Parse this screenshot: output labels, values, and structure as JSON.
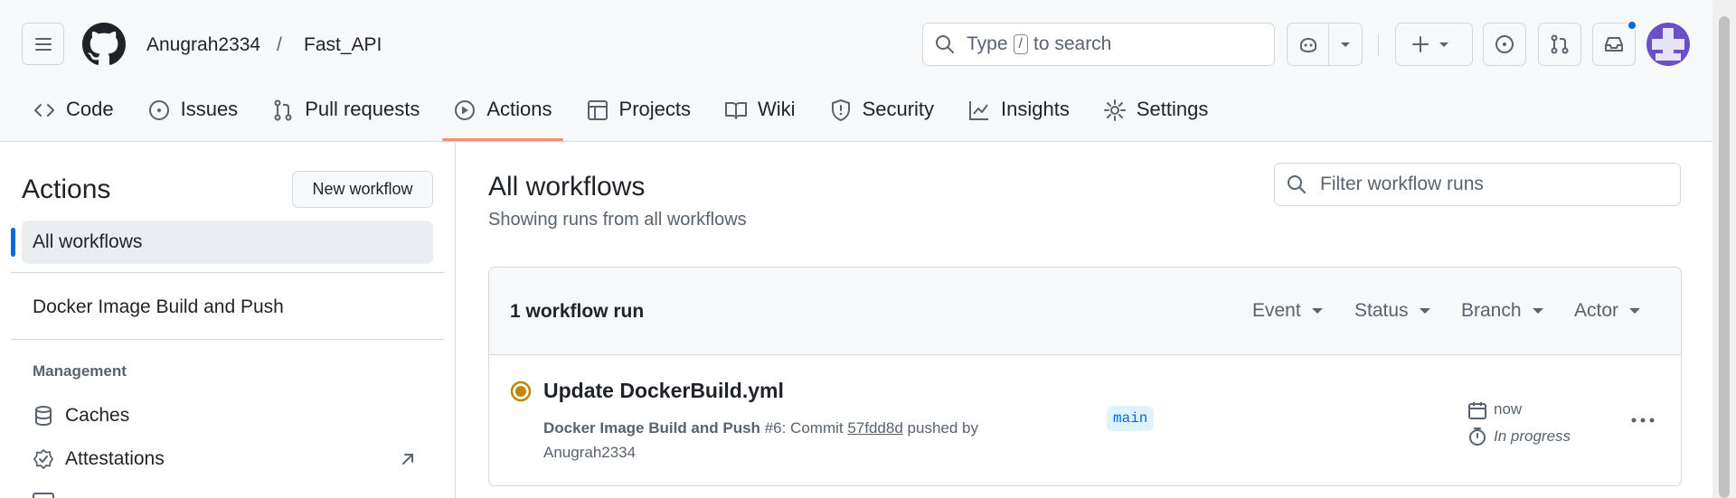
{
  "header": {
    "owner": "Anugrah2334",
    "separator": "/",
    "repo": "Fast_API",
    "search_prefix": "Type",
    "search_key": "/",
    "search_suffix": "to search"
  },
  "tabs": [
    {
      "label": "Code",
      "icon": "code-icon"
    },
    {
      "label": "Issues",
      "icon": "issue-icon"
    },
    {
      "label": "Pull requests",
      "icon": "pull-request-icon"
    },
    {
      "label": "Actions",
      "icon": "play-icon",
      "active": true
    },
    {
      "label": "Projects",
      "icon": "table-icon"
    },
    {
      "label": "Wiki",
      "icon": "book-icon"
    },
    {
      "label": "Security",
      "icon": "shield-icon"
    },
    {
      "label": "Insights",
      "icon": "graph-icon"
    },
    {
      "label": "Settings",
      "icon": "gear-icon"
    }
  ],
  "sidebar": {
    "title": "Actions",
    "new_workflow": "New workflow",
    "all_workflows": "All workflows",
    "workflow_item": "Docker Image Build and Push",
    "management_heading": "Management",
    "caches": "Caches",
    "attestations": "Attestations"
  },
  "main": {
    "title": "All workflows",
    "subtitle": "Showing runs from all workflows",
    "filter_placeholder": "Filter workflow runs",
    "run_count": "1 workflow run",
    "filters": [
      "Event",
      "Status",
      "Branch",
      "Actor"
    ]
  },
  "run": {
    "title": "Update DockerBuild.yml",
    "workflow": "Docker Image Build and Push",
    "number": "#6",
    "commit_prefix": ": Commit",
    "commit": "57fdd8d",
    "pushed_by": "pushed by",
    "author": "Anugrah2334",
    "branch": "main",
    "time": "now",
    "status": "In progress",
    "status_color": "#bf8700"
  },
  "colors": {
    "accent": "#0969da",
    "tab_underline": "#fd8c73",
    "notification_dot": "#0969da"
  }
}
